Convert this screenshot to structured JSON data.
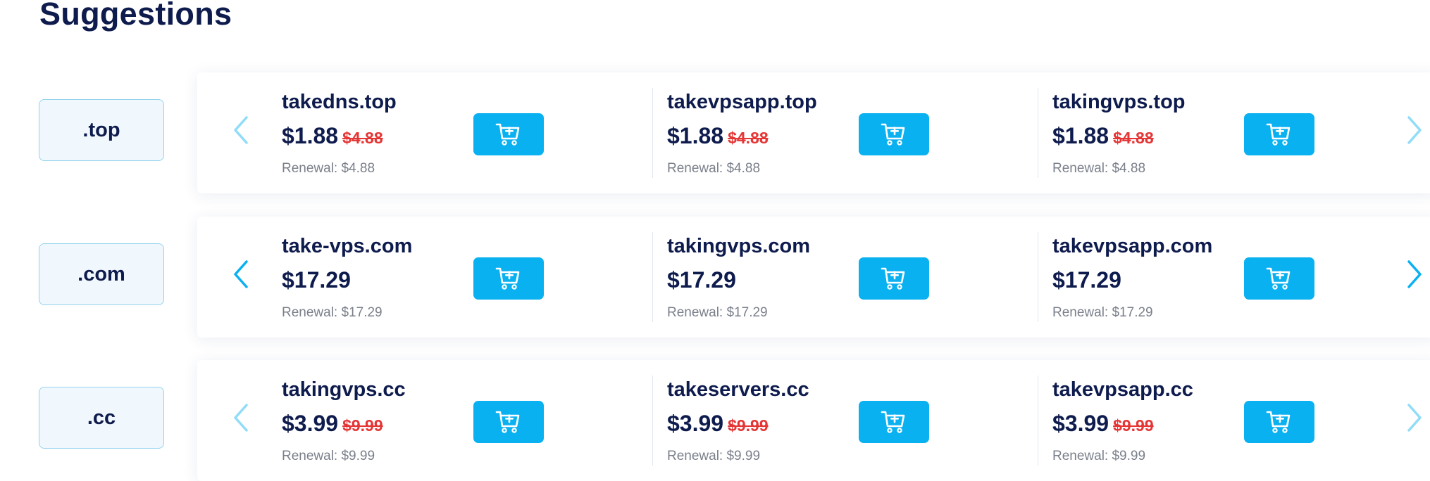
{
  "page": {
    "title": "Suggestions"
  },
  "colors": {
    "accent": "#0ab1f0",
    "heading": "#0e1b4d",
    "strike_price": "#e53535",
    "muted_text": "#7a7f8a",
    "tld_border": "#93d3ec",
    "tld_background": "#f1f8fd"
  },
  "icons": {
    "cart_button": "cart-plus-icon",
    "prev_arrow": "chevron-left-icon",
    "next_arrow": "chevron-right-icon"
  },
  "rows": [
    {
      "tld": ".top",
      "prev_enabled": false,
      "next_enabled": false,
      "items": [
        {
          "domain": "takedns.top",
          "price": "$1.88",
          "old_price": "$4.88",
          "renewal": "Renewal: $4.88"
        },
        {
          "domain": "takevpsapp.top",
          "price": "$1.88",
          "old_price": "$4.88",
          "renewal": "Renewal: $4.88"
        },
        {
          "domain": "takingvps.top",
          "price": "$1.88",
          "old_price": "$4.88",
          "renewal": "Renewal: $4.88"
        }
      ]
    },
    {
      "tld": ".com",
      "prev_enabled": true,
      "next_enabled": true,
      "items": [
        {
          "domain": "take-vps.com",
          "price": "$17.29",
          "old_price": "",
          "renewal": "Renewal: $17.29"
        },
        {
          "domain": "takingvps.com",
          "price": "$17.29",
          "old_price": "",
          "renewal": "Renewal: $17.29"
        },
        {
          "domain": "takevpsapp.com",
          "price": "$17.29",
          "old_price": "",
          "renewal": "Renewal: $17.29"
        }
      ]
    },
    {
      "tld": ".cc",
      "prev_enabled": false,
      "next_enabled": false,
      "items": [
        {
          "domain": "takingvps.cc",
          "price": "$3.99",
          "old_price": "$9.99",
          "renewal": "Renewal: $9.99"
        },
        {
          "domain": "takeservers.cc",
          "price": "$3.99",
          "old_price": "$9.99",
          "renewal": "Renewal: $9.99"
        },
        {
          "domain": "takevpsapp.cc",
          "price": "$3.99",
          "old_price": "$9.99",
          "renewal": "Renewal: $9.99"
        }
      ]
    }
  ]
}
